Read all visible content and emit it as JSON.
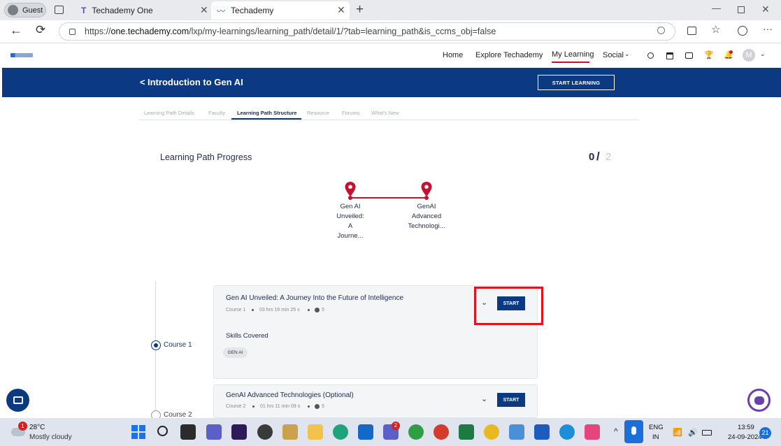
{
  "browser": {
    "profile": "Guest",
    "tabs": [
      {
        "label": "Techademy One"
      },
      {
        "label": "Techademy"
      }
    ],
    "url_prefix": "https://",
    "url_domain": "one.techademy.com",
    "url_path": "/lxp/my-learnings/learning_path/detail/1/?tab=learning_path&is_ccms_obj=false"
  },
  "nav": {
    "items": [
      "Home",
      "Explore Techademy",
      "My Learning",
      "Social"
    ],
    "avatar": "M"
  },
  "banner": {
    "back": "<",
    "title": "Introduction to Gen AI",
    "start_label": "START LEARNING"
  },
  "subtabs": [
    "Learning Path Details",
    "Faculty",
    "Learning Path Structure",
    "Resource",
    "Forums",
    "What's New"
  ],
  "progress": {
    "title": "Learning Path Progress",
    "done": "0",
    "slash": "/",
    "total": "2",
    "nodes": [
      {
        "lines": [
          "Gen AI",
          "Unveiled:",
          "A",
          "Journe..."
        ]
      },
      {
        "lines": [
          "GenAI",
          "Advanced",
          "Technologi..."
        ]
      }
    ]
  },
  "courses": [
    {
      "timeline_label": "Course 1",
      "title": "Gen AI Unveiled: A Journey Into the Future of Intelligence",
      "index": "Course 1",
      "duration": "03 hrs 19 min 25 s",
      "count": "5",
      "skills_title": "Skills Covered",
      "skill": "GEN AI",
      "start": "START"
    },
    {
      "timeline_label": "Course 2",
      "title": "GenAI Advanced Technologies (Optional)",
      "index": "Course 2",
      "duration": "01 hrs 11 min 09 s",
      "count": "5",
      "start": "START"
    }
  ],
  "taskbar": {
    "weather_temp": "28°C",
    "weather_desc": "Mostly cloudy",
    "weather_badge": "1",
    "lang1": "ENG",
    "lang2": "IN",
    "time": "13:59",
    "date": "24-09-2024",
    "notif": "21",
    "teams_badge": "2"
  },
  "colors": {
    "brand": "#0b3a82",
    "accent_red": "#c8102e",
    "highlight": "#e0141e"
  }
}
